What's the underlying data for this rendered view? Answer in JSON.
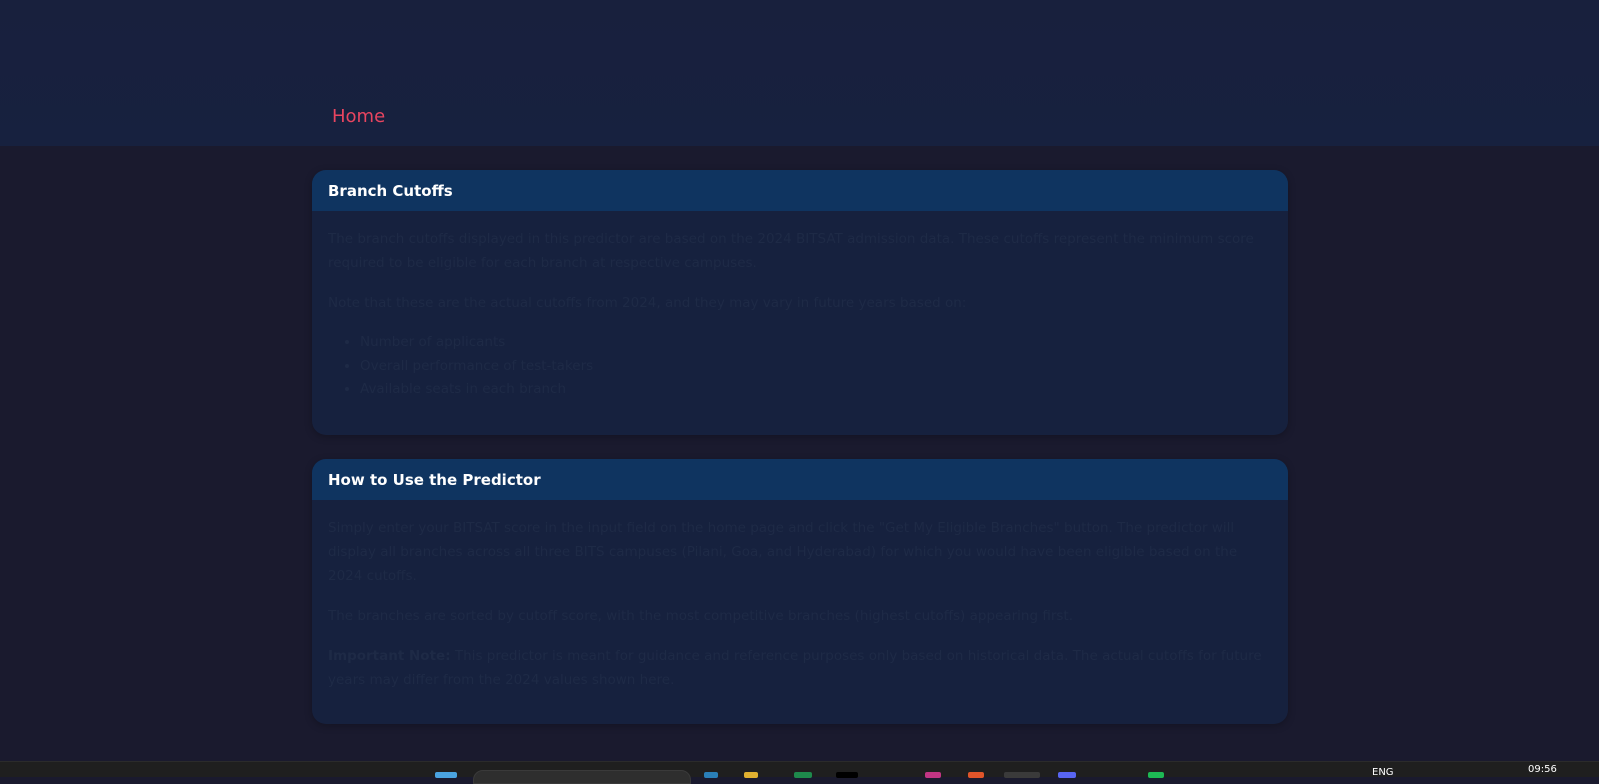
{
  "nav": {
    "home_label": "Home"
  },
  "cards": [
    {
      "title": "Branch Cutoffs",
      "paragraphs": [
        "The branch cutoffs displayed in this predictor are based on the 2024 BITSAT admission data. These cutoffs represent the minimum score required to be eligible for each branch at respective campuses.",
        "Note that these are the actual cutoffs from 2024, and they may vary in future years based on:"
      ],
      "list": [
        "Number of applicants",
        "Overall performance of test-takers",
        "Available seats in each branch"
      ]
    },
    {
      "title": "How to Use the Predictor",
      "paragraphs": [
        "Simply enter your BITSAT score in the input field on the home page and click the \"Get My Eligible Branches\" button. The predictor will display all branches across all three BITS campuses (Pilani, Goa, and Hyderabad) for which you would have been eligible based on the 2024 cutoffs.",
        "The branches are sorted by cutoff score, with the most competitive branches (highest cutoffs) appearing first."
      ],
      "note_label": "Important Note:",
      "note_text": " This predictor is meant for guidance and reference purposes only based on historical data. The actual cutoffs for future years may differ from the 2024 values shown here."
    }
  ],
  "taskbar": {
    "lang": "ENG",
    "time": "09:56"
  },
  "colors": {
    "accent": "#e94560",
    "card_header": "#0f3460",
    "card_body": "#16213e",
    "page_bg": "#1a1a2e"
  }
}
